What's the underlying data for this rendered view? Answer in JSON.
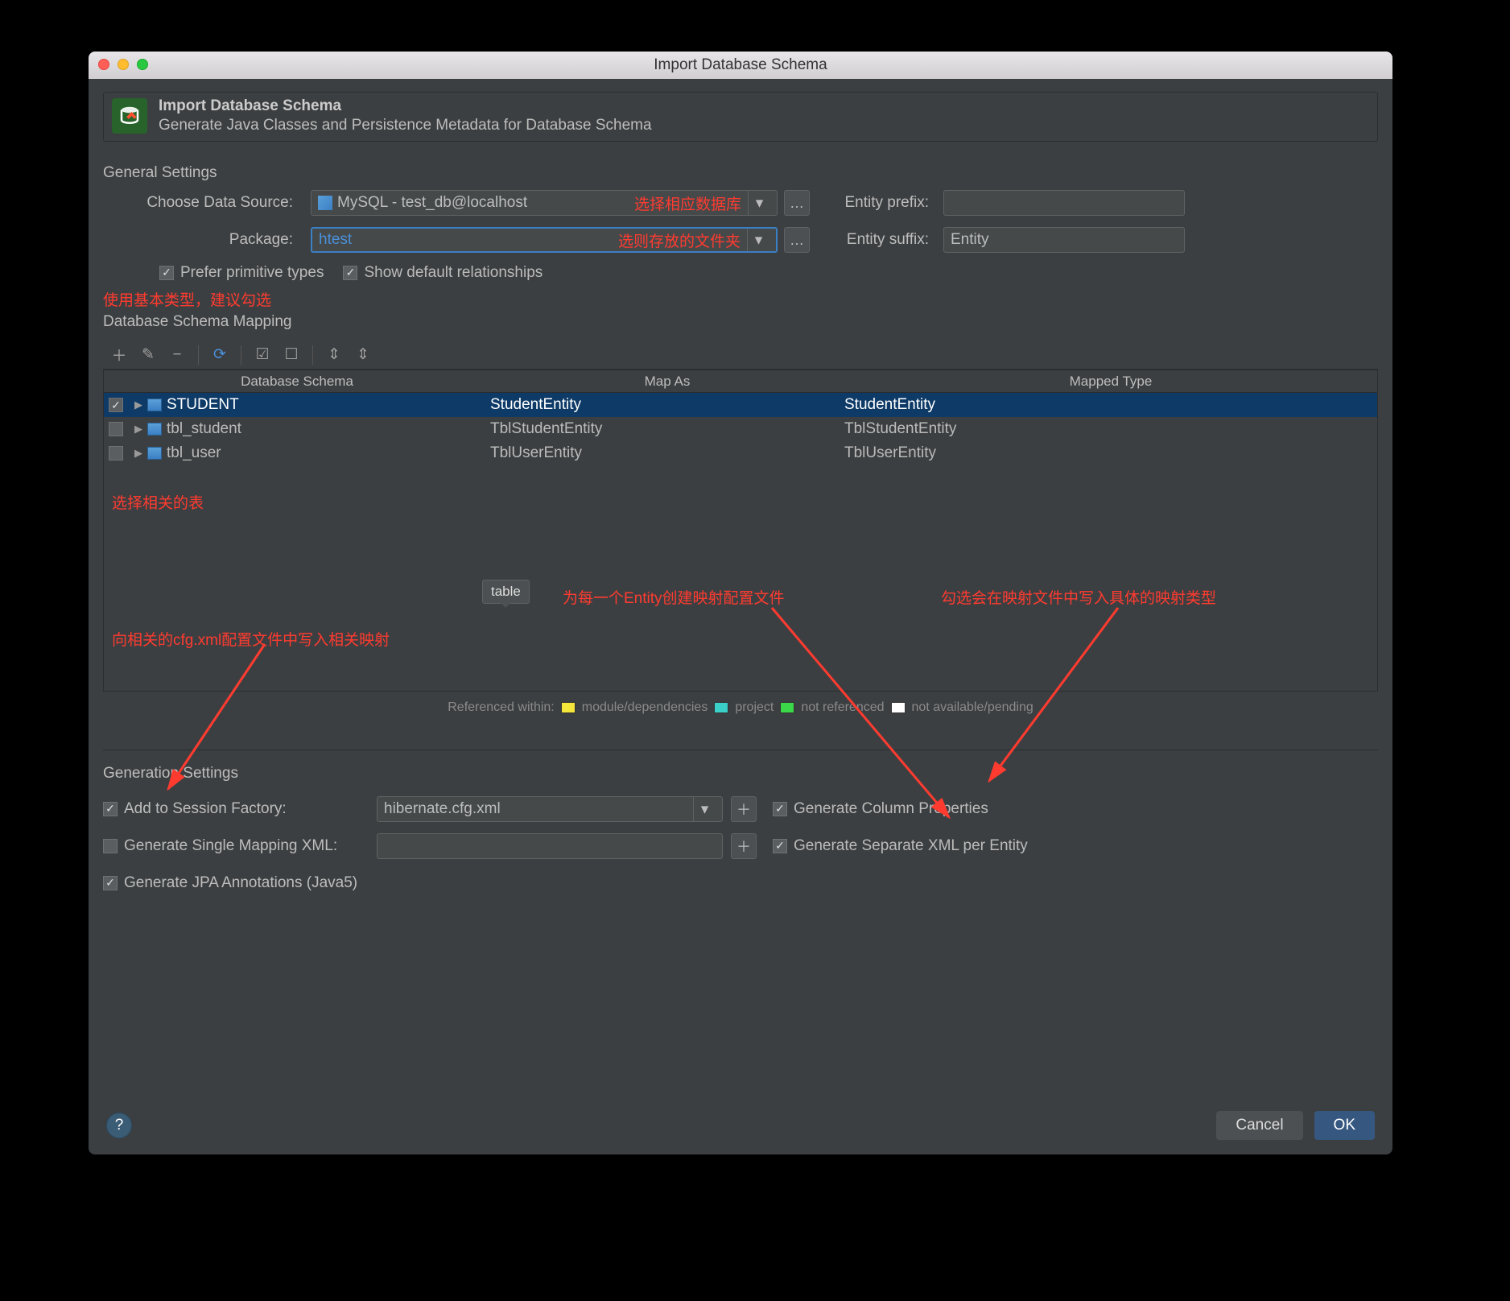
{
  "window": {
    "title": "Import Database Schema"
  },
  "header": {
    "title": "Import Database Schema",
    "subtitle": "Generate Java Classes and Persistence Metadata for Database Schema"
  },
  "general": {
    "section_label": "General Settings",
    "data_source_label": "Choose Data Source:",
    "data_source_value": "MySQL - test_db@localhost",
    "data_source_annotation": "选择相应数据库",
    "package_label": "Package:",
    "package_value": "htest",
    "package_annotation": "选则存放的文件夹",
    "entity_prefix_label": "Entity prefix:",
    "entity_prefix_value": "",
    "entity_suffix_label": "Entity suffix:",
    "entity_suffix_value": "Entity",
    "prefer_primitive_label": "Prefer primitive types",
    "prefer_primitive_checked": true,
    "show_default_label": "Show default relationships",
    "show_default_checked": true,
    "annotation_below": "使用基本类型，建议勾选"
  },
  "mapping": {
    "section_label": "Database Schema Mapping",
    "columns": {
      "c1": "Database Schema",
      "c2": "Map As",
      "c3": "Mapped Type"
    },
    "rows": [
      {
        "checked": true,
        "name": "STUDENT",
        "map_as": "StudentEntity",
        "mapped_type": "StudentEntity",
        "selected": true
      },
      {
        "checked": false,
        "name": "tbl_student",
        "map_as": "TblStudentEntity",
        "mapped_type": "TblStudentEntity",
        "selected": false
      },
      {
        "checked": false,
        "name": "tbl_user",
        "map_as": "TblUserEntity",
        "mapped_type": "TblUserEntity",
        "selected": false
      }
    ],
    "annotation_select_tables": "选择相关的表",
    "tooltip_table": "table",
    "annotation_cfg": "向相关的cfg.xml配置文件中写入相关映射",
    "annotation_per_entity": "为每一个Entity创建映射配置文件",
    "annotation_mapping_type": "勾选会在映射文件中写入具体的映射类型"
  },
  "legend": {
    "prefix": "Referenced within:",
    "module": "module/dependencies",
    "project": "project",
    "not_ref": "not referenced",
    "na": "not available/pending"
  },
  "generation": {
    "section_label": "Generation Settings",
    "add_session_label": "Add to Session Factory:",
    "add_session_checked": true,
    "session_value": "hibernate.cfg.xml",
    "gen_col_props_label": "Generate Column Properties",
    "gen_col_props_checked": true,
    "single_xml_label": "Generate Single Mapping XML:",
    "single_xml_checked": false,
    "single_xml_value": "",
    "sep_xml_label": "Generate Separate XML per Entity",
    "sep_xml_checked": true,
    "jpa_label": "Generate JPA Annotations (Java5)",
    "jpa_checked": true
  },
  "footer": {
    "cancel": "Cancel",
    "ok": "OK"
  }
}
